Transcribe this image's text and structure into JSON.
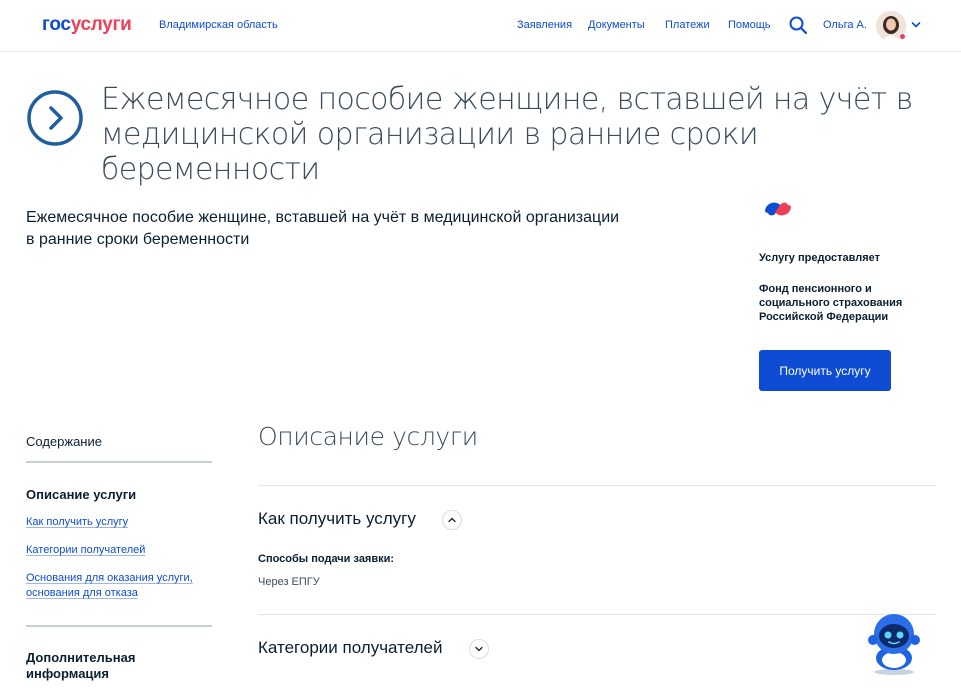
{
  "header": {
    "logo_part1": "гос",
    "logo_part2": "услуги",
    "region": "Владимирская область",
    "nav": [
      "Заявления",
      "Документы",
      "Платежи",
      "Помощь"
    ],
    "user_name": "Ольга А."
  },
  "hero": {
    "title": "Ежемесячное пособие женщине, вставшей на учёт в медицинской организации в ранние сроки беременности"
  },
  "summary": {
    "text": "Ежемесячное пособие женщине, вставшей на учёт в медицинской организации в ранние сроки беременности"
  },
  "provider": {
    "caption": "Услугу предоставляет",
    "name": "Фонд пенсионного и социального страхования Российской Федерации",
    "button_label": "Получить услугу"
  },
  "toc": {
    "heading": "Содержание",
    "active": "Описание услуги",
    "links": [
      "Как получить услугу",
      "Категории получателей",
      "Основания для оказания услуги, основания для отказа"
    ],
    "extra": "Дополнительная информация"
  },
  "main": {
    "section_title": "Описание услуги",
    "accordions": [
      {
        "title": "Как получить услугу",
        "expanded": true
      },
      {
        "title": "Категории получателей",
        "expanded": false
      }
    ],
    "method_label": "Способы подачи заявки:",
    "method_value": "Через ЕПГУ"
  },
  "colors": {
    "brand_blue": "#0d4cd3",
    "brand_red": "#ee3f58",
    "text_dark": "#0b1f33"
  }
}
